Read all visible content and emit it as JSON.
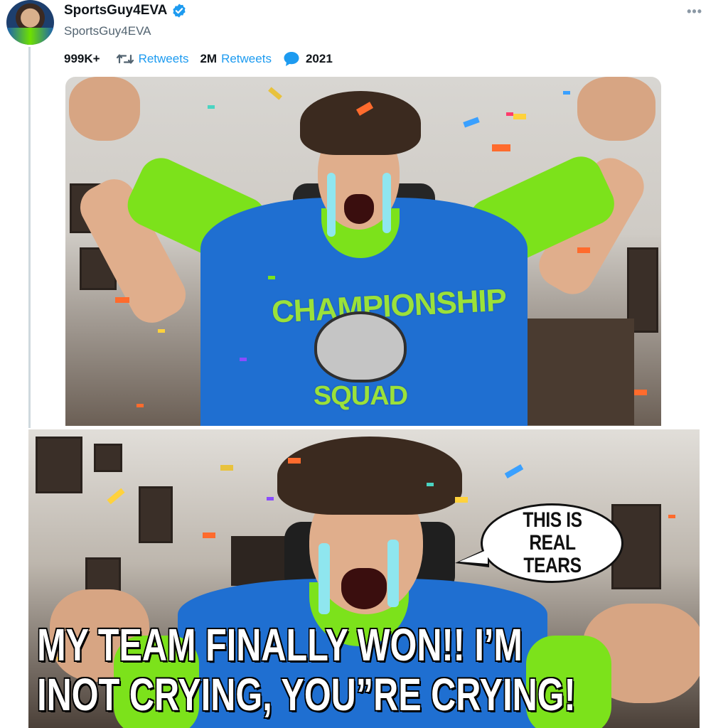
{
  "tweet": {
    "display_name": "SportsGuy4EVA",
    "handle": "SportsGuy4EVA",
    "more_icon": "more-icon",
    "verified_icon": "verified-badge-icon"
  },
  "stats": {
    "likes_count": "999K+",
    "retweets_label_1": "Retweets",
    "retweets_count": "2M",
    "retweets_label_2": "Retweets",
    "replies_count": "2021"
  },
  "meme": {
    "speech_bubble": "THIS IS REAL TEARS",
    "caption_line_1": "MY TEAM FINALLY WON!! I’M",
    "caption_line_2": "INOT CRYING, YOU”RE CRYING!",
    "jersey_text_top": "CHAMPIONSHIP",
    "jersey_text_bottom": "SQUAD"
  },
  "colors": {
    "accent": "#1d9bf0",
    "jersey_blue": "#1f6fd1",
    "jersey_green": "#7ce21b"
  }
}
